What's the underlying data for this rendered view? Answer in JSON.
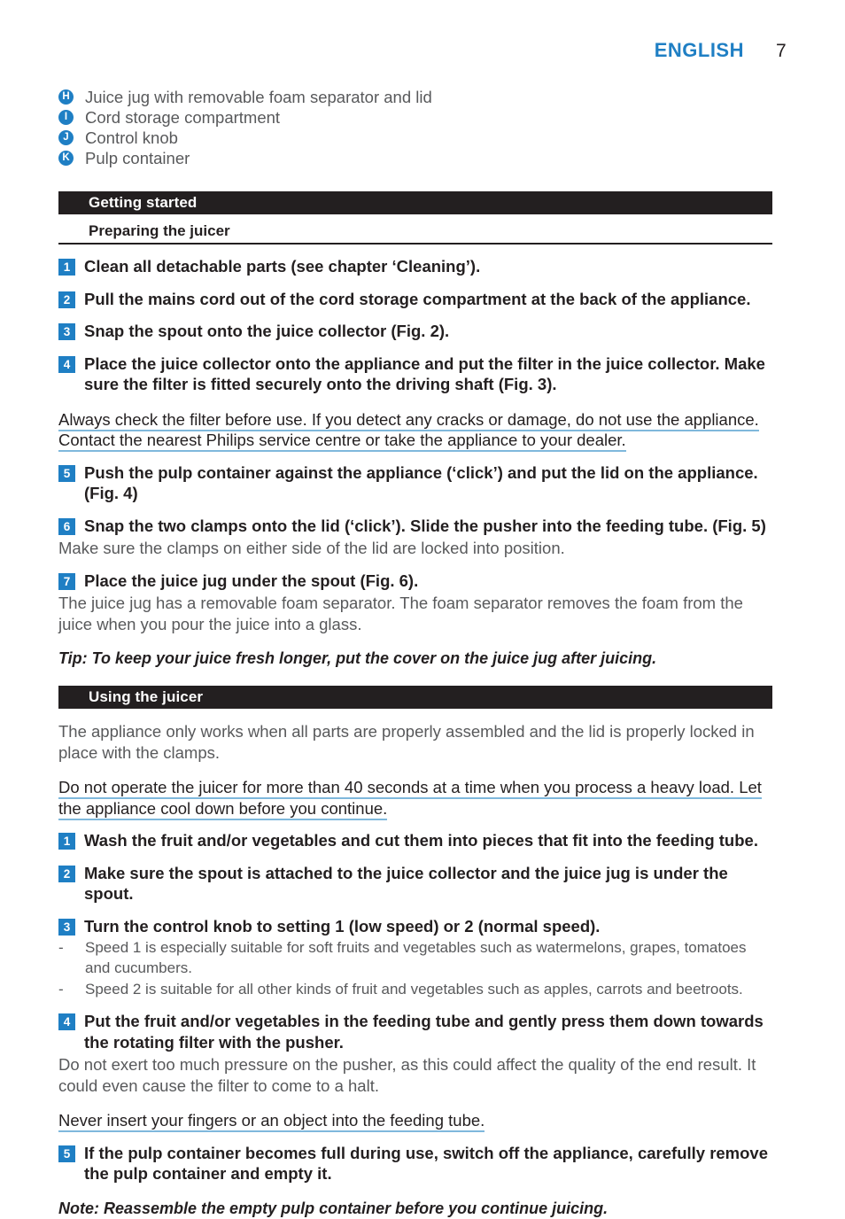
{
  "header": {
    "language": "ENGLISH",
    "page_number": "7"
  },
  "parts_list": [
    {
      "letter": "H",
      "text": "Juice jug with removable foam separator and lid"
    },
    {
      "letter": "I",
      "text": "Cord storage compartment"
    },
    {
      "letter": "J",
      "text": "Control knob"
    },
    {
      "letter": "K",
      "text": "Pulp container"
    }
  ],
  "sections": [
    {
      "bar_title": "Getting started",
      "subhead": "Preparing the juicer",
      "steps": [
        {
          "num": "1",
          "text": "Clean all detachable parts (see chapter ‘Cleaning’)."
        },
        {
          "num": "2",
          "text": "Pull the mains cord out of the cord storage compartment at the back of the appliance."
        },
        {
          "num": "3",
          "text": "Snap the spout onto the juice collector (Fig. 2)."
        },
        {
          "num": "4",
          "text": "Place the juice collector onto the appliance and put the filter in the juice collector. Make sure the filter is fitted securely onto the driving shaft (Fig. 3)."
        }
      ],
      "warning_1": "Always check the filter before use. If you detect any cracks or damage, do not use the appliance. Contact the nearest Philips service centre or take the appliance to your dealer.",
      "step_5": {
        "num": "5",
        "text": "Push the pulp container against the appliance (‘click’) and put the lid on the appliance.  (Fig. 4)"
      },
      "step_6": {
        "num": "6",
        "text": "Snap the two clamps onto the lid (‘click’). Slide the pusher into the feeding tube.  (Fig. 5)"
      },
      "step_6_note": "Make sure the clamps on either side of the lid are locked into position.",
      "step_7": {
        "num": "7",
        "text": "Place the juice jug under the spout (Fig. 6)."
      },
      "step_7_note": "The juice jug has a removable foam separator. The foam separator removes the foam from the juice when you pour the juice into a glass.",
      "tip": "Tip: To keep your juice fresh longer, put the cover on the juice jug after juicing."
    },
    {
      "bar_title": "Using the juicer",
      "intro": "The appliance only works when all parts are properly assembled and the lid is properly locked in place with the clamps.",
      "warning_1": "Do not operate the juicer for more than 40 seconds at a time when you process a heavy load. Let the appliance cool down before you continue.",
      "steps": [
        {
          "num": "1",
          "text": "Wash the fruit and/or vegetables and cut them into pieces that fit into the feeding tube."
        },
        {
          "num": "2",
          "text": "Make sure the spout is attached to the juice collector and the juice jug is under the spout."
        },
        {
          "num": "3",
          "text": "Turn the control knob to setting 1 (low speed) or 2 (normal speed)."
        }
      ],
      "dash_bullets": [
        {
          "mark": "-",
          "text": "Speed 1 is especially suitable for soft fruits and vegetables such as watermelons, grapes, tomatoes and cucumbers."
        },
        {
          "mark": "-",
          "text": " Speed 2 is suitable for all other kinds of fruit and vegetables such as apples, carrots and beetroots."
        }
      ],
      "step_4": {
        "num": "4",
        "text": "Put the fruit and/or vegetables in the feeding tube and gently press them down towards the rotating filter with the pusher."
      },
      "step_4_note": "Do not exert too much pressure on the pusher, as this could affect the quality of the end result. It could even cause the filter to come to a halt.",
      "warning_2": "Never insert your fingers or an object into the feeding tube.",
      "step_5": {
        "num": "5",
        "text": "If the pulp container becomes full during use, switch off the appliance, carefully remove the pulp container and empty it."
      },
      "note": "Note: Reassemble the empty pulp container before you continue juicing."
    }
  ],
  "colors": {
    "accent_blue": "#1f7fc4",
    "underline_blue": "#7fb8dc",
    "bar_black": "#231f20",
    "body_grey": "#58595b"
  }
}
